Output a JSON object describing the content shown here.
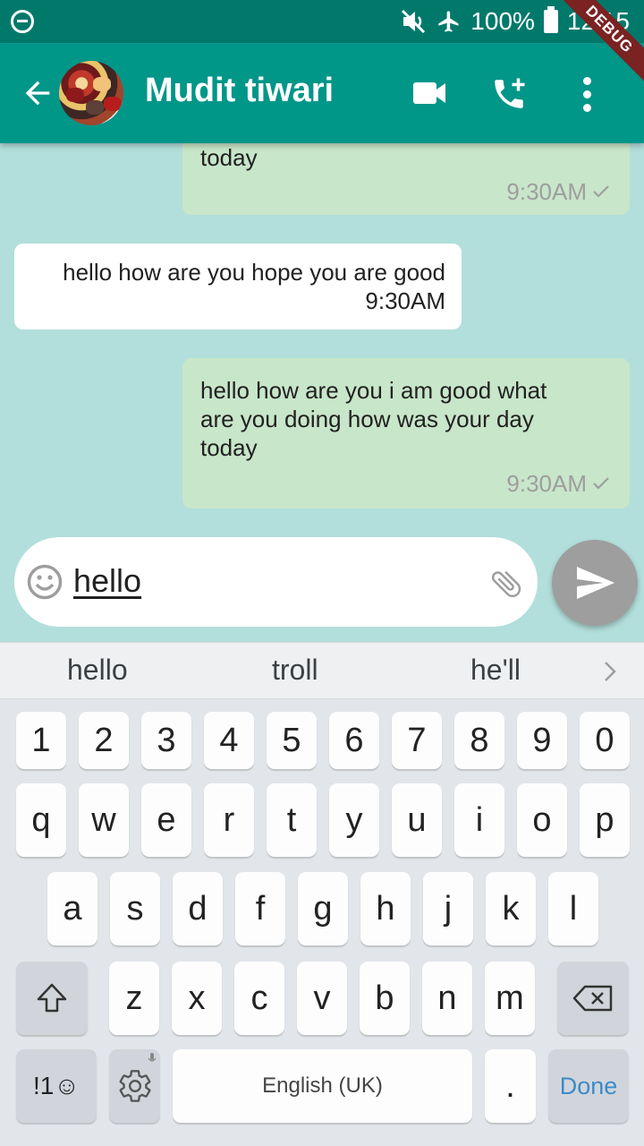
{
  "status_bar": {
    "battery": "100%",
    "time": "12:15"
  },
  "debug_banner": "DEBUG",
  "header": {
    "contact_name": "Mudit tiwari"
  },
  "messages": [
    {
      "side": "sent",
      "text": "today",
      "time": "9:30AM",
      "delivered": true
    },
    {
      "side": "received",
      "text": "hello how are you hope you are good",
      "time": "9:30AM"
    },
    {
      "side": "sent",
      "text": "hello how are you i am good what are you doing how was your day today",
      "time": "9:30AM",
      "delivered": true
    }
  ],
  "composer": {
    "value": "hello"
  },
  "keyboard": {
    "suggestions": [
      "hello",
      "troll",
      "he'll"
    ],
    "row_numbers": [
      "1",
      "2",
      "3",
      "4",
      "5",
      "6",
      "7",
      "8",
      "9",
      "0"
    ],
    "row_top": [
      "q",
      "w",
      "e",
      "r",
      "t",
      "y",
      "u",
      "i",
      "o",
      "p"
    ],
    "row_mid": [
      "a",
      "s",
      "d",
      "f",
      "g",
      "h",
      "j",
      "k",
      "l"
    ],
    "row_bottom": [
      "z",
      "x",
      "c",
      "v",
      "b",
      "n",
      "m"
    ],
    "symbols_label": "!1☺",
    "space_label": "English (UK)",
    "period_label": ".",
    "done_label": "Done"
  },
  "colors": {
    "app_bar": "#009688",
    "status_bar": "#00796b",
    "chat_bg": "#b2dfdb",
    "sent_bubble": "#c8e6c9",
    "received_bubble": "#ffffff",
    "send_button": "#9e9e9e"
  }
}
